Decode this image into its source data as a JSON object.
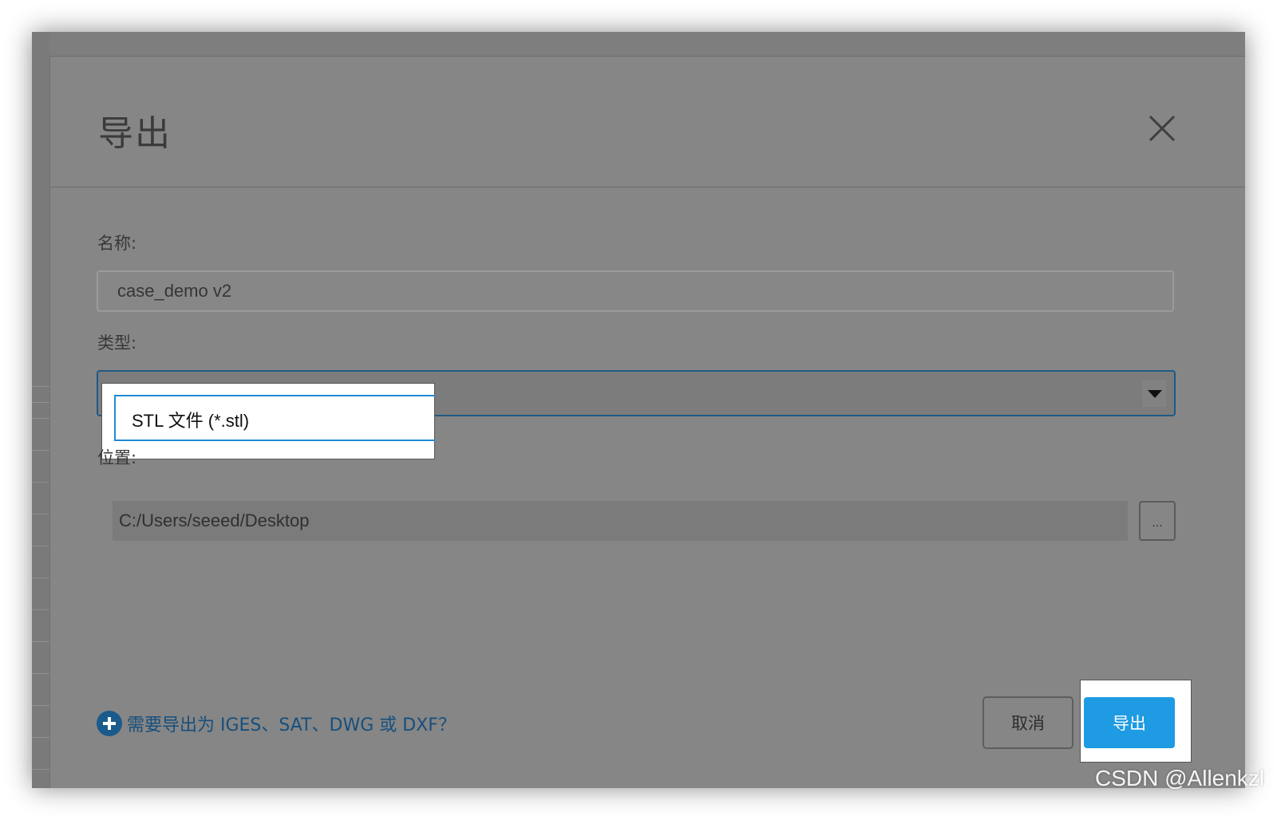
{
  "dialog": {
    "title": "导出",
    "name": {
      "label": "名称:",
      "value": "case_demo v2"
    },
    "type": {
      "label": "类型:",
      "selected": "STL 文件 (*.stl)"
    },
    "location": {
      "label": "位置:",
      "value": "C:/Users/seeed/Desktop",
      "browse_label": "..."
    },
    "help_link": "需要导出为 IGES、SAT、DWG 或 DXF？",
    "buttons": {
      "cancel": "取消",
      "export": "导出"
    }
  },
  "watermark": "CSDN @Allenkzl",
  "colors": {
    "overlay": "#868686",
    "primary_button": "#1e9be2",
    "select_focus_border": "#1e5a86",
    "help_link": "#174f7c"
  },
  "icons": {
    "close": "close-icon",
    "help": "help-plus-icon",
    "select_arrow": "chevron-down-icon"
  }
}
